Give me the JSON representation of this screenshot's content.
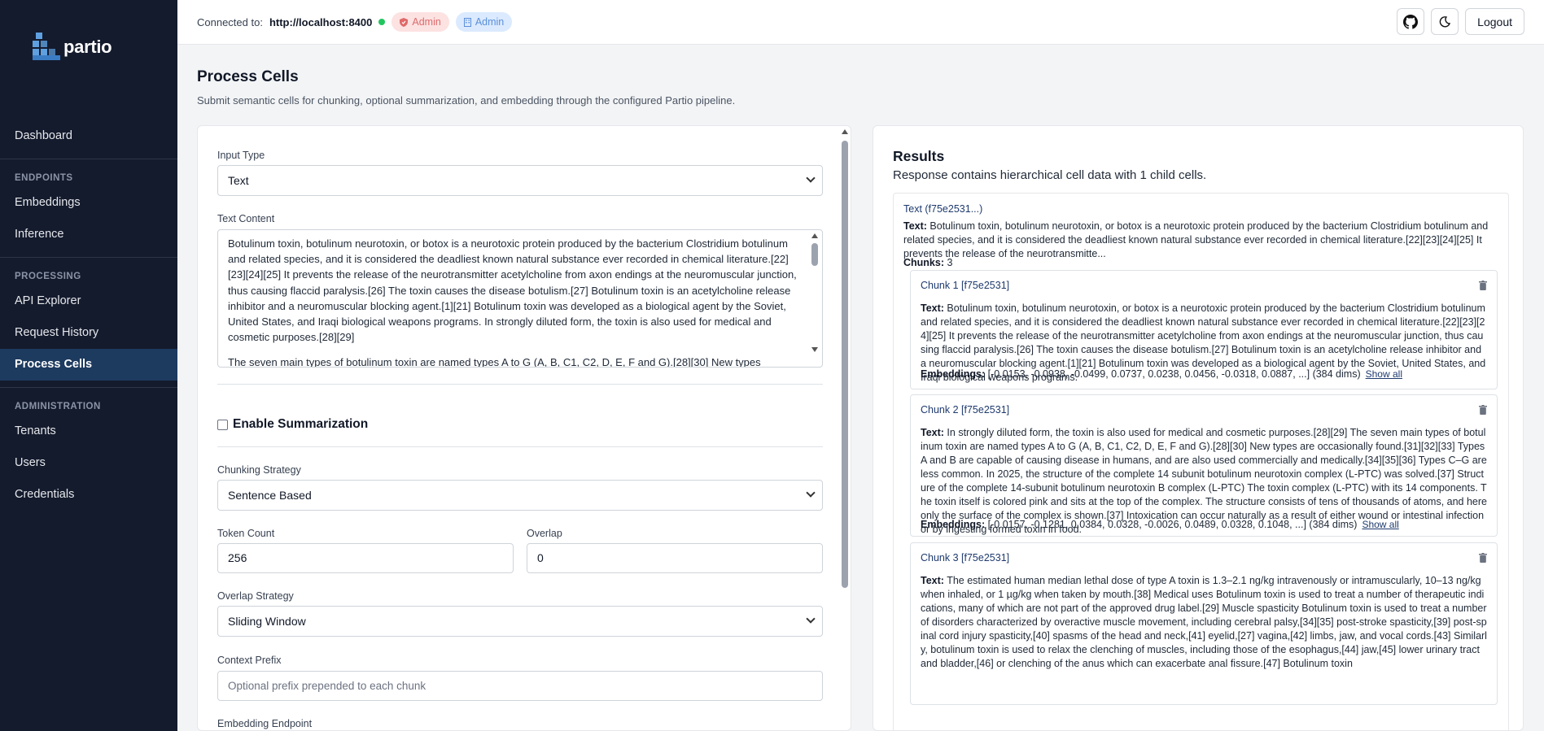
{
  "brand": {
    "name": "partio"
  },
  "sidebar": {
    "top_items": [
      {
        "label": "Dashboard"
      }
    ],
    "sections": [
      {
        "title": "ENDPOINTS",
        "items": [
          {
            "label": "Embeddings"
          },
          {
            "label": "Inference"
          }
        ]
      },
      {
        "title": "PROCESSING",
        "items": [
          {
            "label": "API Explorer"
          },
          {
            "label": "Request History"
          },
          {
            "label": "Process Cells"
          }
        ]
      },
      {
        "title": "ADMINISTRATION",
        "items": [
          {
            "label": "Tenants"
          },
          {
            "label": "Users"
          },
          {
            "label": "Credentials"
          }
        ]
      }
    ],
    "active": "Process Cells"
  },
  "topbar": {
    "connected_label": "Connected to:",
    "url": "http://localhost:8400",
    "badges": [
      "Admin",
      "Admin"
    ],
    "logout_label": "Logout",
    "icons": [
      "github-icon",
      "moon-icon"
    ]
  },
  "page": {
    "title": "Process Cells",
    "subtitle": "Submit semantic cells for chunking, optional summarization, and embedding through the configured Partio pipeline."
  },
  "form": {
    "input_type_label": "Input Type",
    "input_type_value": "Text",
    "text_content_label": "Text Content",
    "text_content_p1": "Botulinum toxin, botulinum neurotoxin, or botox is a neurotoxic protein produced by the bacterium Clostridium botulinum and related species, and it is considered the deadliest known natural substance ever recorded in chemical literature.[22][23][24][25] It prevents the release of the neurotransmitter acetylcholine from axon endings at the neuromuscular junction, thus causing flaccid paralysis.[26] The toxin causes the disease botulism.[27] Botulinum toxin is an acetylcholine release inhibitor and a neuromuscular blocking agent.[1][21] Botulinum toxin was developed as a biological agent by the Soviet, United States, and Iraqi biological weapons programs. In strongly diluted form, the toxin is also used for medical and cosmetic purposes.[28][29]",
    "text_content_p2": "The seven main types of botulinum toxin are named types A to G (A, B, C1, C2, D, E, F and G).[28][30] New types",
    "summarization_label": "Enable Summarization",
    "chunking_strategy_label": "Chunking Strategy",
    "chunking_strategy_value": "Sentence Based",
    "token_count_label": "Token Count",
    "token_count_value": "256",
    "overlap_label": "Overlap",
    "overlap_value": "0",
    "overlap_strategy_label": "Overlap Strategy",
    "overlap_strategy_value": "Sliding Window",
    "context_prefix_label": "Context Prefix",
    "context_prefix_placeholder": "Optional prefix prepended to each chunk",
    "embedding_endpoint_label": "Embedding Endpoint"
  },
  "results": {
    "title": "Results",
    "subtitle": "Response contains hierarchical cell data with 1 child cells.",
    "cell_head": "Text (f75e2531...)",
    "text_label": "Text:",
    "cell_text": "Botulinum toxin, botulinum neurotoxin, or botox is a neurotoxic protein produced by the bacterium Clostridium botulinum and related species, and it is considered the deadliest known natural substance ever recorded in chemical literature.[22][23][24][25] It prevents the release of the neurotransmitte...",
    "chunks_label": "Chunks:",
    "chunks_count": "3",
    "embeddings_label": "Embeddings:",
    "show_all_label": "Show all",
    "chunks": [
      {
        "head": "Chunk 1 [f75e2531]",
        "text": "Botulinum toxin, botulinum neurotoxin, or botox is a neurotoxic protein produced by the bacterium Clostridium botulinum and related species, and it is considered the deadliest known natural substance ever recorded in chemical literature.[22][23][24][25] It prevents the release of the neurotransmitter acetylcholine from axon endings at the neuromuscular junction, thus causing flaccid paralysis.[26] The toxin causes the disease botulism.[27] Botulinum toxin is an acetylcholine release inhibitor and a neuromuscular blocking agent.[1][21] Botulinum toxin was developed as a biological agent by the Soviet, United States, and Iraqi biological weapons programs.",
        "embeddings": "[-0.0153, -0.0938, -0.0499, 0.0737, 0.0238, 0.0456, -0.0318, 0.0887, ...] (384 dims)"
      },
      {
        "head": "Chunk 2 [f75e2531]",
        "text": "In strongly diluted form, the toxin is also used for medical and cosmetic purposes.[28][29] The seven main types of botulinum toxin are named types A to G (A, B, C1, C2, D, E, F and G).[28][30] New types are occasionally found.[31][32][33] Types A and B are capable of causing disease in humans, and are also used commercially and medically.[34][35][36] Types C–G are less common. In 2025, the structure of the complete 14 subunit botulinum neurotoxin complex (L-PTC) was solved.[37] Structure of the complete 14-subunit botulinum neurotoxin B complex (L-PTC) The toxin complex (L-PTC) with its 14 components. The toxin itself is colored pink and sits at the top of the complex. The structure consists of tens of thousands of atoms, and here only the surface of the complex is shown.[37] Intoxication can occur naturally as a result of either wound or intestinal infection or by ingesting formed toxin in food.",
        "embeddings": "[-0.0157, -0.1281, 0.0384, 0.0328, -0.0026, 0.0489, 0.0328, 0.1048, ...] (384 dims)"
      },
      {
        "head": "Chunk 3 [f75e2531]",
        "text": "The estimated human median lethal dose of type A toxin is 1.3–2.1 ng/kg intravenously or intramuscularly, 10–13 ng/kg when inhaled, or 1 µg/kg when taken by mouth.[38] Medical uses Botulinum toxin is used to treat a number of therapeutic indications, many of which are not part of the approved drug label.[29] Muscle spasticity Botulinum toxin is used to treat a number of disorders characterized by overactive muscle movement, including cerebral palsy,[34][35] post-stroke spasticity,[39] post-spinal cord injury spasticity,[40] spasms of the head and neck,[41] eyelid,[27] vagina,[42] limbs, jaw, and vocal cords.[43] Similarly, botulinum toxin is used to relax the clenching of muscles, including those of the esophagus,[44] jaw,[45] lower urinary tract and bladder,[46] or clenching of the anus which can exacerbate anal fissure.[47] Botulinum toxin",
        "embeddings": ""
      }
    ]
  },
  "colors": {
    "sidebar_bg": "#141b2d",
    "active_bg": "#1d3a5f",
    "link": "#1e3a6e",
    "online": "#22c55e"
  }
}
